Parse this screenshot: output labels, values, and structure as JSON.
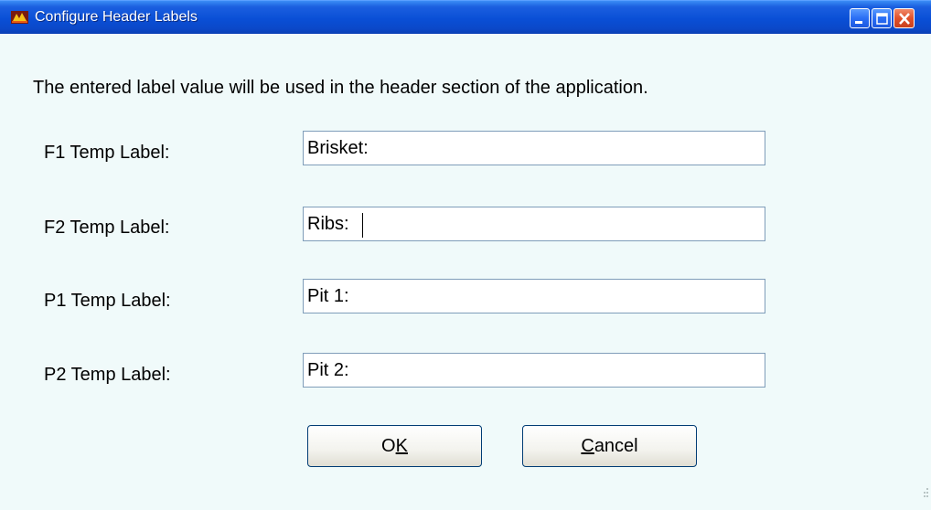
{
  "window": {
    "title": "Configure Header Labels"
  },
  "dialog": {
    "description": "The entered label value will be used in the header section of the application.",
    "fields": [
      {
        "label": "F1 Temp Label:",
        "value": "Brisket:"
      },
      {
        "label": "F2 Temp Label:",
        "value": "Ribs:"
      },
      {
        "label": "P1 Temp Label:",
        "value": "Pit 1:"
      },
      {
        "label": "P2 Temp Label:",
        "value": "Pit 2:"
      }
    ],
    "ok_label": "OK",
    "ok_mnemonic": "K",
    "cancel_label": "Cancel",
    "cancel_mnemonic": "C"
  },
  "icons": {
    "app": "app-icon",
    "minimize": "minimize-icon",
    "maximize": "maximize-icon",
    "close": "close-icon",
    "resize_grip": "resize-grip-icon"
  },
  "colors": {
    "titlebar": "#0a4fd6",
    "client_background": "#f0fafa",
    "close_button": "#e0502a",
    "input_border": "#7f9db9",
    "button_border": "#003c74"
  }
}
